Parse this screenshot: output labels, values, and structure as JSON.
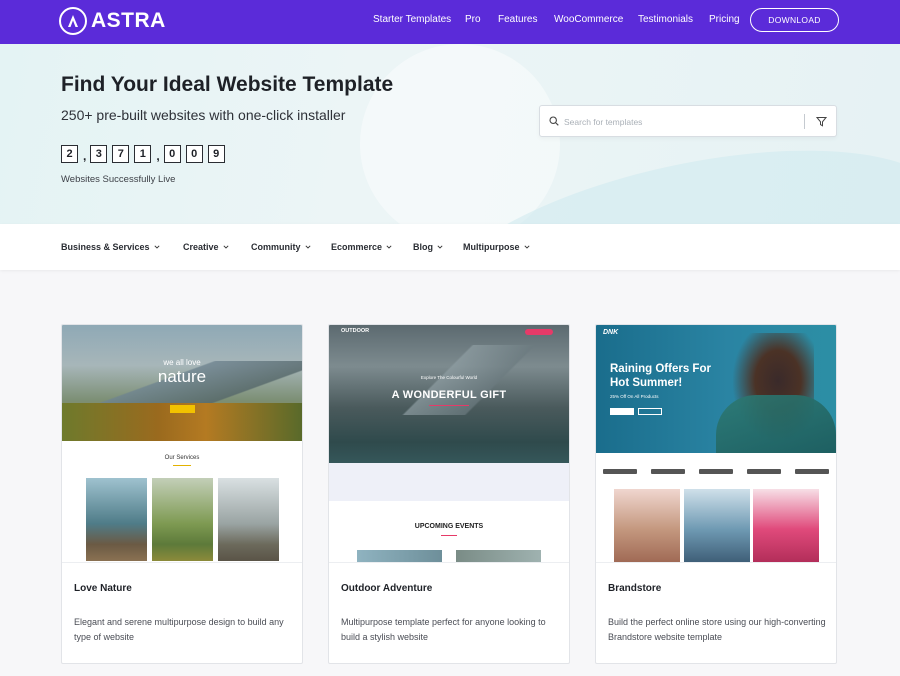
{
  "header": {
    "brand": "ASTRA",
    "nav": [
      "Starter Templates",
      "Pro",
      "Features",
      "WooCommerce",
      "Testimonials",
      "Pricing"
    ],
    "download_label": "DOWNLOAD"
  },
  "hero": {
    "title": "Find Your Ideal Website Template",
    "subtitle": "250+ pre-built websites with one-click installer",
    "counter_digits": [
      "2",
      "3",
      "7",
      "1",
      "0",
      "0",
      "9"
    ],
    "counter_label": "Websites Successfully Live",
    "search_placeholder": "Search for templates"
  },
  "categories": [
    "Business & Services",
    "Creative",
    "Community",
    "Ecommerce",
    "Blog",
    "Multipurpose"
  ],
  "cards": [
    {
      "title": "Love Nature",
      "description": "Elegant and serene multipurpose design to build any type of website",
      "thumb": {
        "tagline": "we all love",
        "headline": "nature",
        "section": "Our Services"
      }
    },
    {
      "title": "Outdoor Adventure",
      "description": "Multipurpose template perfect for anyone looking to build a stylish website",
      "thumb": {
        "brand": "OUTDOOR",
        "kicker": "Explore The Colourful World",
        "headline": "A WONDERFUL GIFT",
        "section": "UPCOMING EVENTS"
      }
    },
    {
      "title": "Brandstore",
      "description": "Build the perfect online store using our high-converting Brandstore website template",
      "thumb": {
        "brand": "DNK",
        "headline": "Raining Offers For Hot Summer!",
        "offer": "25% Off On All Products"
      }
    }
  ],
  "colors": {
    "header_bg": "#5b2bd9",
    "accent_pink": "#e63a68",
    "accent_yellow": "#f2c200"
  }
}
